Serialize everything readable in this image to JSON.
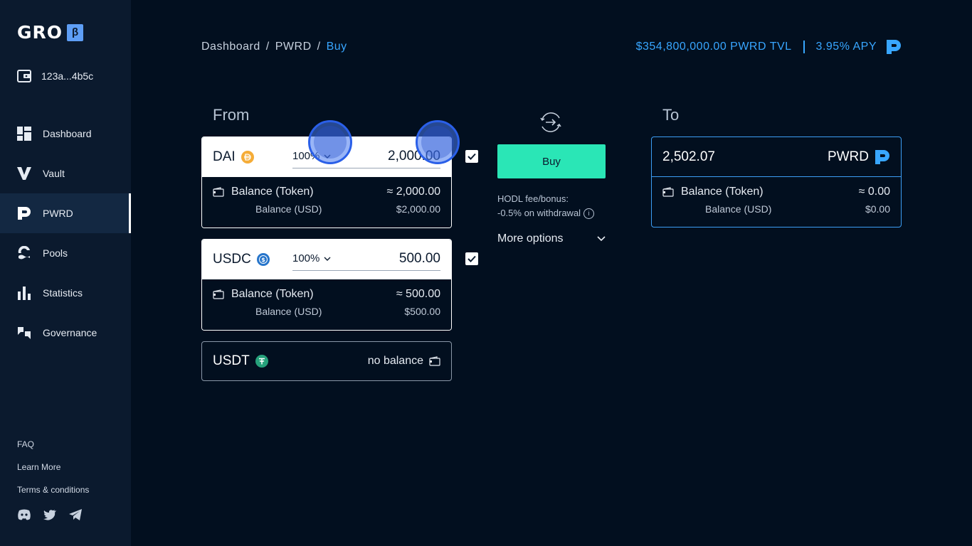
{
  "brand": {
    "name": "GRO",
    "badge": "β"
  },
  "wallet": {
    "address": "123a...4b5c"
  },
  "nav": [
    {
      "label": "Dashboard",
      "icon": "dashboard-icon"
    },
    {
      "label": "Vault",
      "icon": "vault-icon"
    },
    {
      "label": "PWRD",
      "icon": "pwrd-icon",
      "active": true
    },
    {
      "label": "Pools",
      "icon": "pools-icon"
    },
    {
      "label": "Statistics",
      "icon": "statistics-icon"
    },
    {
      "label": "Governance",
      "icon": "governance-icon"
    }
  ],
  "footer": {
    "faq": "FAQ",
    "learn_more": "Learn More",
    "terms": "Terms & conditions"
  },
  "breadcrumb": {
    "item1": "Dashboard",
    "item2": "PWRD",
    "current": "Buy",
    "sep": "/"
  },
  "stats": {
    "tvl": "$354,800,000.00 PWRD TVL",
    "apy": "3.95% APY"
  },
  "from": {
    "label": "From",
    "dai": {
      "name": "DAI",
      "pct": "100%",
      "amount": "2,000.00",
      "bal_token_label": "Balance (Token)",
      "bal_token": "≈ 2,000.00",
      "bal_usd_label": "Balance (USD)",
      "bal_usd": "$2,000.00"
    },
    "usdc": {
      "name": "USDC",
      "pct": "100%",
      "amount": "500.00",
      "bal_token_label": "Balance (Token)",
      "bal_token": "≈ 500.00",
      "bal_usd_label": "Balance (USD)",
      "bal_usd": "$500.00"
    },
    "usdt": {
      "name": "USDT",
      "no_balance": "no balance"
    }
  },
  "action": {
    "buy_label": "Buy",
    "fee_line1": "HODL fee/bonus:",
    "fee_line2": "-0.5% on withdrawal",
    "more_options": "More options"
  },
  "to": {
    "label": "To",
    "amount": "2,502.07",
    "token": "PWRD",
    "bal_token_label": "Balance (Token)",
    "bal_token": "≈ 0.00",
    "bal_usd_label": "Balance (USD)",
    "bal_usd": "$0.00"
  },
  "colors": {
    "accent": "#38a6ff",
    "buy": "#2ae6b6",
    "dai": "#f5ac37",
    "usdc": "#2775ca",
    "usdt": "#26a17b"
  }
}
